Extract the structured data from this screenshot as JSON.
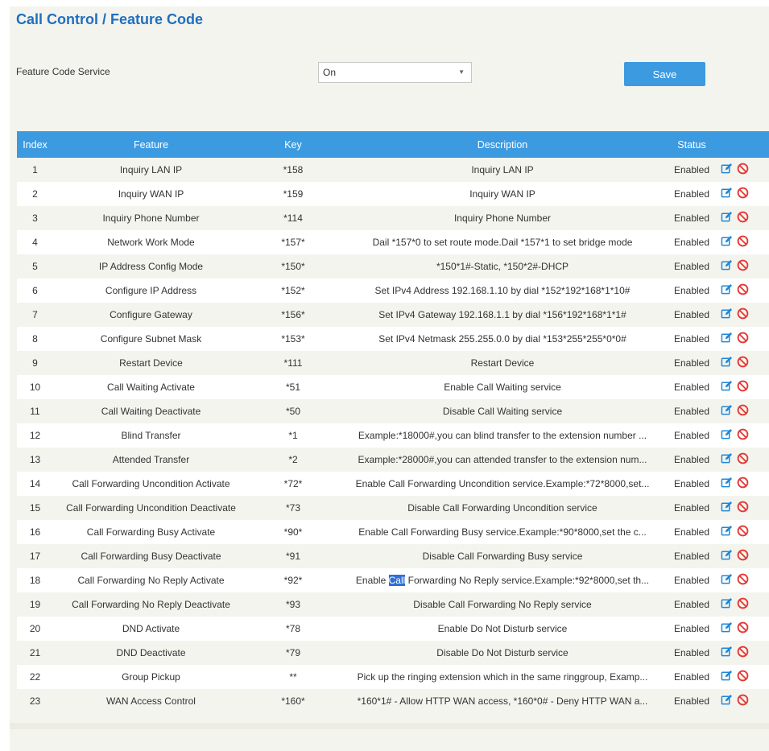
{
  "page": {
    "title": "Call Control / Feature Code"
  },
  "service": {
    "label": "Feature Code Service",
    "select_value": "On",
    "save_label": "Save"
  },
  "table": {
    "headers": {
      "index": "Index",
      "feature": "Feature",
      "key": "Key",
      "description": "Description",
      "status": "Status"
    },
    "rows": [
      {
        "index": "1",
        "feature": "Inquiry LAN IP",
        "key": "*158",
        "description": "Inquiry LAN IP",
        "status": "Enabled"
      },
      {
        "index": "2",
        "feature": "Inquiry WAN IP",
        "key": "*159",
        "description": "Inquiry WAN IP",
        "status": "Enabled"
      },
      {
        "index": "3",
        "feature": "Inquiry Phone Number",
        "key": "*114",
        "description": "Inquiry Phone Number",
        "status": "Enabled"
      },
      {
        "index": "4",
        "feature": "Network Work Mode",
        "key": "*157*",
        "description": "Dail *157*0 to set route mode.Dail *157*1 to set bridge mode",
        "status": "Enabled"
      },
      {
        "index": "5",
        "feature": "IP Address Config Mode",
        "key": "*150*",
        "description": "*150*1#-Static, *150*2#-DHCP",
        "status": "Enabled"
      },
      {
        "index": "6",
        "feature": "Configure IP Address",
        "key": "*152*",
        "description": "Set IPv4 Address 192.168.1.10 by dial *152*192*168*1*10#",
        "status": "Enabled"
      },
      {
        "index": "7",
        "feature": "Configure Gateway",
        "key": "*156*",
        "description": "Set IPv4 Gateway 192.168.1.1 by dial *156*192*168*1*1#",
        "status": "Enabled"
      },
      {
        "index": "8",
        "feature": "Configure Subnet Mask",
        "key": "*153*",
        "description": "Set IPv4 Netmask 255.255.0.0 by dial *153*255*255*0*0#",
        "status": "Enabled"
      },
      {
        "index": "9",
        "feature": "Restart Device",
        "key": "*111",
        "description": "Restart Device",
        "status": "Enabled"
      },
      {
        "index": "10",
        "feature": "Call Waiting Activate",
        "key": "*51",
        "description": "Enable Call Waiting service",
        "status": "Enabled"
      },
      {
        "index": "11",
        "feature": "Call Waiting Deactivate",
        "key": "*50",
        "description": "Disable Call Waiting service",
        "status": "Enabled"
      },
      {
        "index": "12",
        "feature": "Blind Transfer",
        "key": "*1",
        "description": "Example:*18000#,you can blind transfer to the extension number ...",
        "status": "Enabled"
      },
      {
        "index": "13",
        "feature": "Attended Transfer",
        "key": "*2",
        "description": "Example:*28000#,you can attended transfer to the extension num...",
        "status": "Enabled"
      },
      {
        "index": "14",
        "feature": "Call Forwarding Uncondition Activate",
        "key": "*72*",
        "description": "Enable Call Forwarding Uncondition service.Example:*72*8000,set...",
        "status": "Enabled"
      },
      {
        "index": "15",
        "feature": "Call Forwarding Uncondition Deactivate",
        "key": "*73",
        "description": "Disable Call Forwarding Uncondition service",
        "status": "Enabled"
      },
      {
        "index": "16",
        "feature": "Call Forwarding Busy Activate",
        "key": "*90*",
        "description": "Enable Call Forwarding Busy service.Example:*90*8000,set the c...",
        "status": "Enabled"
      },
      {
        "index": "17",
        "feature": "Call Forwarding Busy Deactivate",
        "key": "*91",
        "description": "Disable Call Forwarding Busy service",
        "status": "Enabled"
      },
      {
        "index": "18",
        "feature": "Call Forwarding No Reply Activate",
        "key": "*92*",
        "description_pre": "Enable ",
        "description_hl": "Call",
        "description_post": " Forwarding No Reply service.Example:*92*8000,set th...",
        "status": "Enabled"
      },
      {
        "index": "19",
        "feature": "Call Forwarding No Reply Deactivate",
        "key": "*93",
        "description": "Disable Call Forwarding No Reply service",
        "status": "Enabled"
      },
      {
        "index": "20",
        "feature": "DND Activate",
        "key": "*78",
        "description": "Enable Do Not Disturb service",
        "status": "Enabled"
      },
      {
        "index": "21",
        "feature": "DND Deactivate",
        "key": "*79",
        "description": "Disable Do Not Disturb service",
        "status": "Enabled"
      },
      {
        "index": "22",
        "feature": "Group Pickup",
        "key": "**",
        "description": "Pick up the ringing extension which in the same ringgroup, Examp...",
        "status": "Enabled"
      },
      {
        "index": "23",
        "feature": "WAN Access Control",
        "key": "*160*",
        "description": "*160*1# - Allow HTTP WAN access, *160*0# - Deny HTTP WAN a...",
        "status": "Enabled"
      }
    ]
  },
  "icons": {
    "edit": "edit-icon",
    "disable": "disable-icon",
    "edit_color": "#1e88d8",
    "disable_color": "#e53935"
  }
}
